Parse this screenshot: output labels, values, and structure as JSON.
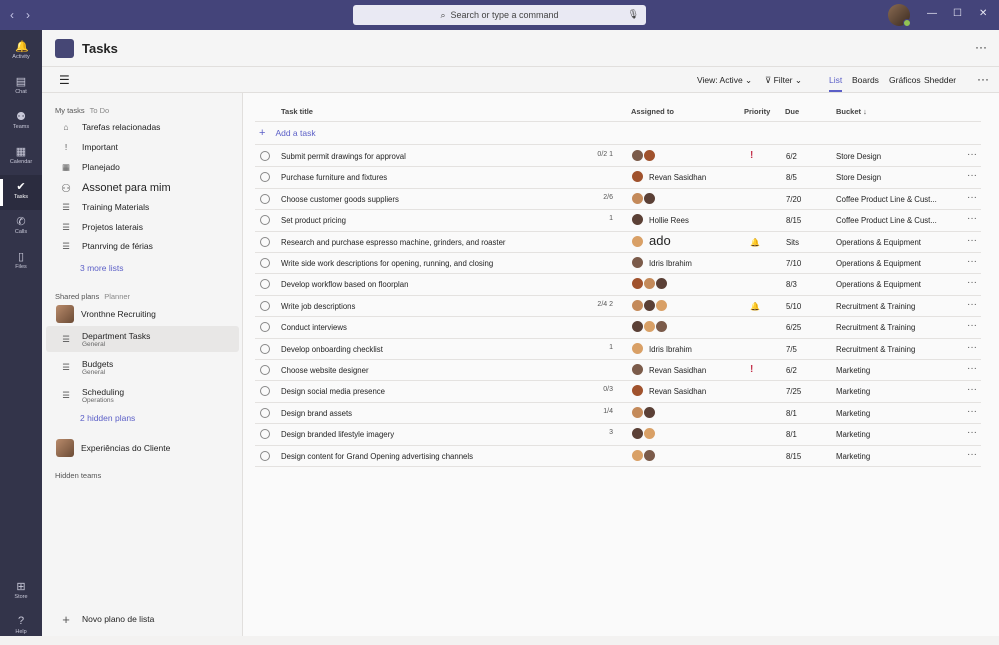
{
  "titlebar": {
    "search_placeholder": "Search or type a command"
  },
  "rail": [
    {
      "label": "Activity",
      "icon": "bell-icon"
    },
    {
      "label": "Chat",
      "icon": "chat-icon"
    },
    {
      "label": "Teams",
      "icon": "teams-icon"
    },
    {
      "label": "Calendar",
      "icon": "calendar-icon"
    },
    {
      "label": "Tasks",
      "icon": "tasks-icon",
      "active": true
    },
    {
      "label": "Calls",
      "icon": "phone-icon"
    },
    {
      "label": "Files",
      "icon": "file-icon"
    },
    {
      "label": "Store",
      "icon": "store-icon"
    },
    {
      "label": "Help",
      "icon": "help-icon"
    }
  ],
  "header": {
    "title": "Tasks"
  },
  "toolbar": {
    "view": "View: Active",
    "filter": "Filter",
    "tabs": [
      "List",
      "Boards",
      "Gráficos",
      "Shedder"
    ]
  },
  "sidebar": {
    "my_tasks": "My tasks",
    "my_tasks_sub": "To Do",
    "items": [
      "Tarefas relacionadas",
      "Important",
      "Planejado",
      "Assonet para mim",
      "Training Materials",
      "Projetos laterais",
      "Ptanrving de férias"
    ],
    "more_lists": "3 more lists",
    "shared": "Shared plans",
    "shared_sub": "Planner",
    "plans": [
      {
        "name": "Vronthne Recruiting",
        "sub": ""
      },
      {
        "name": "Department Tasks",
        "sub": "General"
      },
      {
        "name": "Budgets",
        "sub": "General"
      },
      {
        "name": "Scheduling",
        "sub": "Operations"
      }
    ],
    "hidden_plans": "2 hidden plans",
    "customer": "Experiências do Cliente",
    "hidden_teams": "Hidden teams",
    "new_list": "Novo plano de lista"
  },
  "table": {
    "headers": {
      "title": "Task title",
      "assigned": "Assigned to",
      "priority": "Priority",
      "due": "Due",
      "bucket": "Bucket ↓"
    },
    "add_task": "Add a task",
    "rows": [
      {
        "title": "Submit permit drawings for approval",
        "meta": "0/2  1",
        "name": "",
        "prio": "!",
        "due": "6/2",
        "bucket": "Store Design"
      },
      {
        "title": "Purchase furniture and fixtures",
        "meta": "",
        "name": "Revan Sasidhan",
        "prio": "",
        "due": "8/5",
        "bucket": "Store Design"
      },
      {
        "title": "Choose customer goods suppliers",
        "meta": "2/6",
        "name": "",
        "prio": "",
        "due": "7/20",
        "bucket": "Coffee Product Line & Cust..."
      },
      {
        "title": "Set product pricing",
        "meta": "1",
        "name": "Hollie Rees",
        "prio": "",
        "due": "8/15",
        "bucket": "Coffee Product Line & Cust..."
      },
      {
        "title": "Research and purchase espresso machine, grinders, and roaster",
        "meta": "",
        "name": "ado",
        "prio": "🔔",
        "due": "Sits",
        "bucket": "Operations & Equipment"
      },
      {
        "title": "Write side work descriptions for opening, running, and closing",
        "meta": "",
        "name": "Idris Ibrahim",
        "prio": "",
        "due": "7/10",
        "bucket": "Operations & Equipment"
      },
      {
        "title": "Develop workflow based on floorplan",
        "meta": "",
        "name": "",
        "prio": "",
        "due": "8/3",
        "bucket": "Operations & Equipment"
      },
      {
        "title": "Write job descriptions",
        "meta": "2/4  2",
        "name": "",
        "prio": "🔔",
        "due": "5/10",
        "bucket": "Recruitment & Training"
      },
      {
        "title": "Conduct interviews",
        "meta": "",
        "name": "",
        "prio": "",
        "due": "6/25",
        "bucket": "Recruitment & Training"
      },
      {
        "title": "Develop onboarding checklist",
        "meta": "1",
        "name": "Idris Ibrahim",
        "prio": "",
        "due": "7/5",
        "bucket": "Recruitment & Training"
      },
      {
        "title": "Choose website designer",
        "meta": "",
        "name": "Revan Sasidhan",
        "prio": "!",
        "due": "6/2",
        "bucket": "Marketing"
      },
      {
        "title": "Design social media presence",
        "meta": "0/3",
        "name": "Revan Sasidhan",
        "prio": "",
        "due": "7/25",
        "bucket": "Marketing"
      },
      {
        "title": "Design brand assets",
        "meta": "1/4",
        "name": "",
        "prio": "",
        "due": "8/1",
        "bucket": "Marketing"
      },
      {
        "title": "Design branded lifestyle imagery",
        "meta": "3",
        "name": "",
        "prio": "",
        "due": "8/1",
        "bucket": "Marketing"
      },
      {
        "title": "Design content for Grand Opening advertising channels",
        "meta": "",
        "name": "",
        "prio": "",
        "due": "8/15",
        "bucket": "Marketing"
      }
    ]
  },
  "colors": {
    "accent": "#5b5fc7",
    "titlebar": "#44447a",
    "rail": "#33344a",
    "urgent": "#c4314b"
  }
}
